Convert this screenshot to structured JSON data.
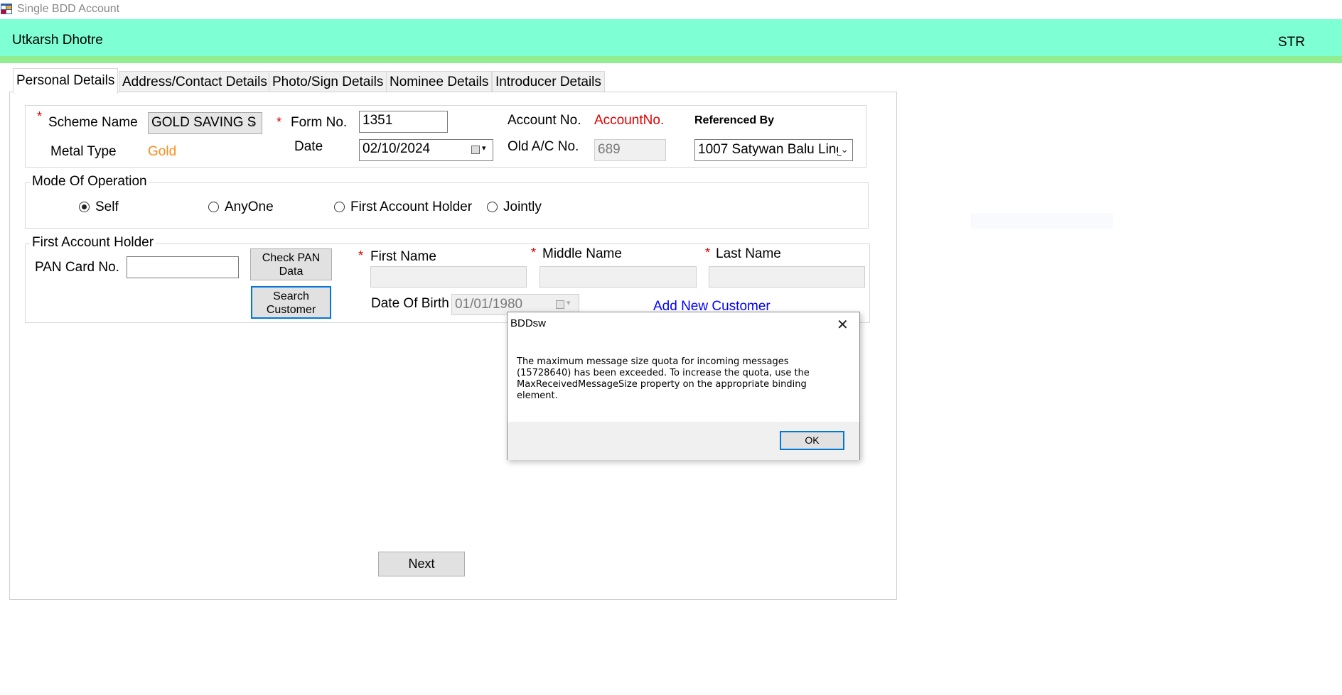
{
  "window": {
    "title": "Single BDD Account"
  },
  "header": {
    "user_name": "Utkarsh Dhotre",
    "role": "STR"
  },
  "tabs": [
    {
      "label": "Personal Details",
      "active": true
    },
    {
      "label": "Address/Contact Details"
    },
    {
      "label": "Photo/Sign Details"
    },
    {
      "label": "Nominee Details"
    },
    {
      "label": "Introducer Details"
    }
  ],
  "scheme": {
    "required_mark": "*",
    "scheme_name_label": "Scheme Name",
    "scheme_name_value": "GOLD SAVING S",
    "form_no_label": "Form No.",
    "form_no_value": "1351",
    "account_no_label": "Account No.",
    "account_no_value": "AccountNo.",
    "referenced_by_label": "Referenced By",
    "referenced_by_value": "1007 Satywan Balu Ling",
    "metal_type_label": "Metal Type",
    "metal_type_value": "Gold",
    "date_label": "Date",
    "date_value": "02/10/2024",
    "old_ac_label": "Old A/C No.",
    "old_ac_value": "689"
  },
  "mode_of_operation": {
    "legend": "Mode Of Operation",
    "options": [
      {
        "label": "Self",
        "checked": true
      },
      {
        "label": "AnyOne",
        "checked": false
      },
      {
        "label": "First Account Holder",
        "checked": false
      },
      {
        "label": "Jointly",
        "checked": false
      }
    ]
  },
  "first_account_holder": {
    "legend": "First Account Holder",
    "pan_label": "PAN Card No.",
    "pan_value": "",
    "check_pan_button": "Check PAN Data",
    "search_customer_button": "Search Customer",
    "first_name_label": "First Name",
    "middle_name_label": "Middle Name",
    "last_name_label": "Last Name",
    "dob_label": "Date Of Birth",
    "dob_value": "01/01/1980",
    "add_new_customer_link": "Add New Customer"
  },
  "footer": {
    "next_button": "Next"
  },
  "dialog": {
    "title": "BDDsw",
    "message": "The maximum message size quota for incoming messages (15728640) has been exceeded. To increase the quota, use the MaxReceivedMessageSize property on the appropriate binding element.",
    "ok_button": "OK"
  },
  "colors": {
    "header_bg": "#7fffd4",
    "header_strip": "#90ee90",
    "required": "#e00000",
    "account_no_value": "#e00000",
    "metal_type_value": "#ff8c1a",
    "link": "#0000ff",
    "focus_border": "#0078d7"
  },
  "icons": {
    "app_icon": "app-window-icon",
    "dropdown": "chevron-down-icon",
    "calendar": "calendar-icon",
    "close": "close-icon"
  }
}
